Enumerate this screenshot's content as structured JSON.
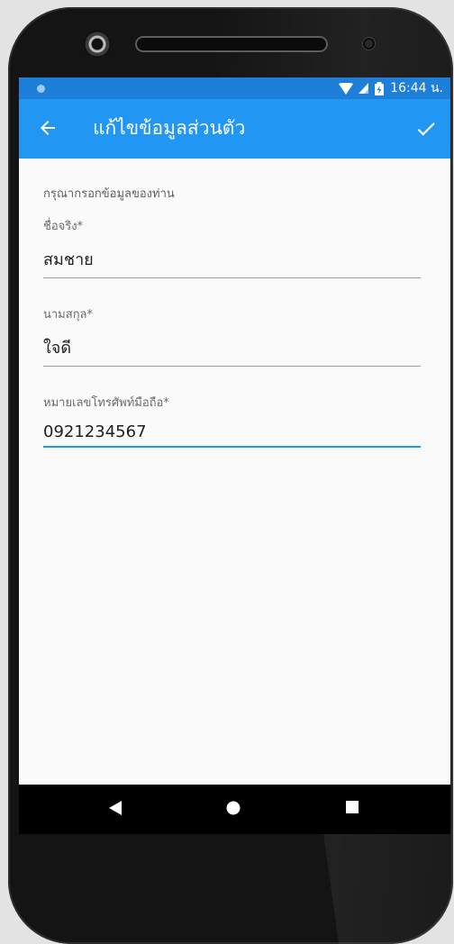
{
  "status_bar": {
    "time": "16:44 น.",
    "icons": [
      "notification-dot-icon",
      "wifi-icon",
      "signal-icon",
      "battery-icon"
    ]
  },
  "app_bar": {
    "title": "แก้ไขข้อมูลส่วนตัว",
    "back_icon": "arrow-left-icon",
    "confirm_icon": "check-icon"
  },
  "form": {
    "hint": "กรุณากรอกข้อมูลของท่าน",
    "fields": [
      {
        "label": "ชื่อจริง*",
        "value": "สมชาย"
      },
      {
        "label": "นามสกุล*",
        "value": "ใจดี"
      },
      {
        "label": "หมายเลขโทรศัพท์มือถือ*",
        "value": "0921234567",
        "focused": true
      }
    ]
  },
  "nav_bar": {
    "buttons": [
      "back-triangle-icon",
      "home-circle-icon",
      "recents-square-icon"
    ]
  },
  "colors": {
    "status_bar": "#1e7fd8",
    "app_bar": "#2196f3",
    "focus_underline": "#2196f3",
    "screen_bg": "#fafafa"
  }
}
